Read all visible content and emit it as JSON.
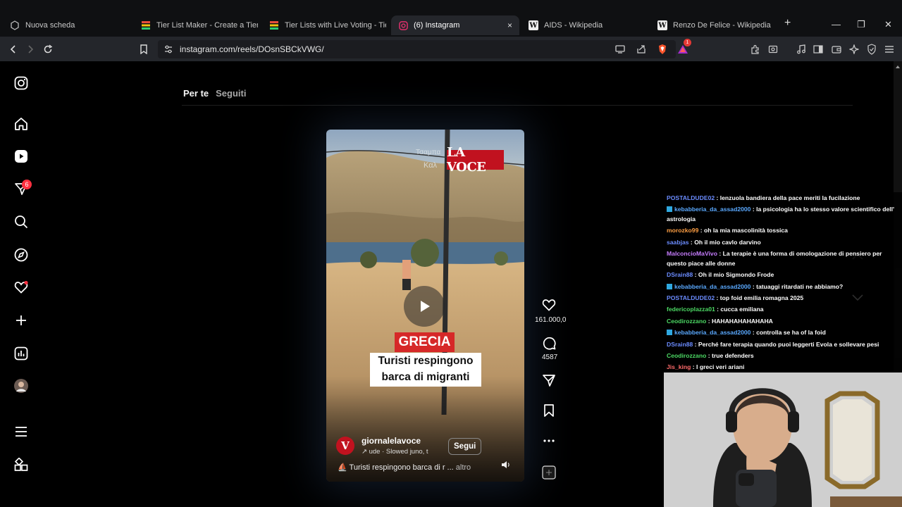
{
  "browser": {
    "tabs": [
      {
        "title": "Nuova scheda",
        "icon": "new-tab-icon",
        "active": false
      },
      {
        "title": "Tier List Maker - Create a Tier Li",
        "icon": "tiermaker-icon",
        "active": false
      },
      {
        "title": "Tier Lists with Live Voting - Tier",
        "icon": "tiermaker-icon",
        "active": false
      },
      {
        "title": "(6) Instagram",
        "icon": "instagram-icon",
        "active": true
      },
      {
        "title": "AIDS - Wikipedia",
        "icon": "wikipedia-icon",
        "active": false
      },
      {
        "title": "Renzo De Felice - Wikipedia",
        "icon": "wikipedia-icon",
        "active": false
      }
    ],
    "new_tab_label": "+",
    "close_label": "×",
    "url": "instagram.com/reels/DOsnSBCkVWG/",
    "brave_alert_count": "1",
    "controls": {
      "minimize": "—",
      "maximize": "❐",
      "close": "✕"
    }
  },
  "instagram": {
    "sidebar": [
      {
        "name": "instagram-logo-icon"
      },
      {
        "name": "home-icon"
      },
      {
        "name": "reels-icon"
      },
      {
        "name": "direct-messages-icon"
      },
      {
        "name": "search-icon"
      },
      {
        "name": "explore-icon"
      },
      {
        "name": "notifications-icon"
      },
      {
        "name": "create-icon"
      },
      {
        "name": "dashboard-icon"
      },
      {
        "name": "profile-avatar"
      },
      {
        "name": "menu-icon"
      },
      {
        "name": "also-from-meta-icon"
      }
    ],
    "messages_badge": "6",
    "feed_tabs": {
      "for_you": "Per te",
      "following": "Seguiti"
    },
    "reel": {
      "watermark": "LA VOCE",
      "overlay_text_faint_1": "Τσαμπα",
      "overlay_text_faint_2": "Καλ",
      "tag": "GRECIA",
      "caption_line_1": "Turisti respingono",
      "caption_line_2": "barca di migranti",
      "author": "giornalelavoce",
      "author_initial": "V",
      "audio": "↗  ude · Slowed  juno, t",
      "follow_label": "Segui",
      "description": "⛵ Turisti respingono barca di r ...",
      "more_label": "altro"
    },
    "actions": {
      "likes": "161.000,0",
      "comments": "4587"
    }
  },
  "stream": {
    "chat": [
      {
        "user": "POSTALDUDE02",
        "color": "#6b8cff",
        "badge": false,
        "text": "lenzuola bandiera della pace meriti la fucilazione"
      },
      {
        "user": "kebabberia_da_assad2000",
        "color": "#5aa9ff",
        "badge": true,
        "text": "la psicologia ha lo stesso valore scientifico dell' astrologia",
        "wrap": true
      },
      {
        "user": "morozko99",
        "color": "#ff9f43",
        "badge": false,
        "text": "oh la mia mascolinità tossica"
      },
      {
        "user": "saabjas",
        "color": "#6b8cff",
        "badge": false,
        "text": "Oh il mio cavlo darvino"
      },
      {
        "user": "MalconcioMaVivo",
        "color": "#c77dff",
        "badge": false,
        "text": "La terapie è una forma di omologazione di pensiero per questo piace alle donne",
        "wrap": true
      },
      {
        "user": "DSrain88",
        "color": "#6b8cff",
        "badge": false,
        "text": "Oh il mio Sigmondo Frode"
      },
      {
        "user": "kebabberia_da_assad2000",
        "color": "#5aa9ff",
        "badge": true,
        "text": "tatuaggi ritardati ne abbiamo?"
      },
      {
        "user": "POSTALDUDE02",
        "color": "#6b8cff",
        "badge": false,
        "text": "top foid emilia romagna 2025"
      },
      {
        "user": "federicoplazza01",
        "color": "#4cd964",
        "badge": false,
        "text": "cucca emiliana"
      },
      {
        "user": "Ceodirozzano",
        "color": "#4cd964",
        "badge": false,
        "text": "HAHAHAHAHAHAHA"
      },
      {
        "user": "kebabberia_da_assad2000",
        "color": "#5aa9ff",
        "badge": true,
        "text": "controlla se ha of la foid"
      },
      {
        "user": "DSrain88",
        "color": "#6b8cff",
        "badge": false,
        "text": "Perché fare terapia quando puoi leggerti Evola e sollevare pesi"
      },
      {
        "user": "Ceodirozzano",
        "color": "#4cd964",
        "badge": false,
        "text": "true defenders"
      },
      {
        "user": "Jis_king",
        "color": "#ff6b6b",
        "badge": false,
        "text": "I greci veri ariani"
      }
    ]
  }
}
